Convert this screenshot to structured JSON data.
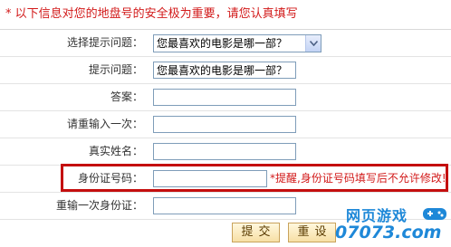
{
  "notice": "* 以下信息对您的地盘号的安全极为重要，请您认真填写",
  "rows": {
    "select_question": {
      "label": "选择提示问题：",
      "value": "您最喜欢的电影是哪一部？"
    },
    "question": {
      "label": "提示问题：",
      "value": "您最喜欢的电影是哪一部？"
    },
    "answer": {
      "label": "答案：",
      "value": ""
    },
    "answer_confirm": {
      "label": "请重输入一次：",
      "value": ""
    },
    "real_name": {
      "label": "真实姓名：",
      "value": ""
    },
    "id_card": {
      "label": "身份证号码：",
      "value": "",
      "hint": "*提醒,身份证号码填写后不允许修改!"
    },
    "id_card_confirm": {
      "label": "重输一次身份证：",
      "value": ""
    }
  },
  "buttons": {
    "submit": "提交",
    "reset": "重设"
  },
  "watermark": {
    "top": "网页游戏",
    "bottom": "07073.com"
  },
  "colors": {
    "accent_red": "#c40e0e",
    "notice_red": "#d21a1a",
    "logo_blue": "#1e88d8"
  }
}
